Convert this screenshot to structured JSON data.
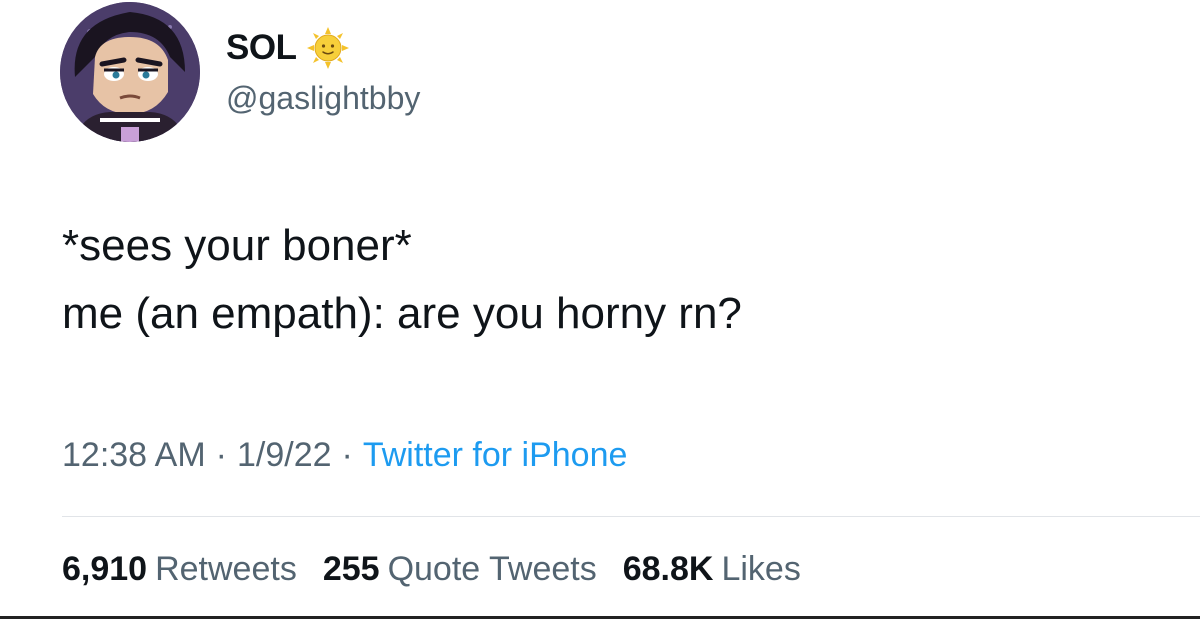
{
  "author": {
    "display_name": "SOL",
    "badge_icon": "sun-face-icon",
    "handle": "@gaslightbby",
    "avatar": "cartoon-character-avatar"
  },
  "tweet": {
    "lines": [
      "*sees your boner*",
      "me (an empath): are you horny rn?"
    ]
  },
  "meta": {
    "time": "12:38 AM",
    "date": "1/9/22",
    "separator": "·",
    "source": "Twitter for iPhone"
  },
  "stats": {
    "retweets": {
      "count": "6,910",
      "label": "Retweets"
    },
    "quotes": {
      "count": "255",
      "label": "Quote Tweets"
    },
    "likes": {
      "count": "68.8K",
      "label": "Likes"
    }
  },
  "colors": {
    "text": "#0f1419",
    "secondary": "#536471",
    "link": "#1d9bf0",
    "divider": "#e1e4e8"
  }
}
